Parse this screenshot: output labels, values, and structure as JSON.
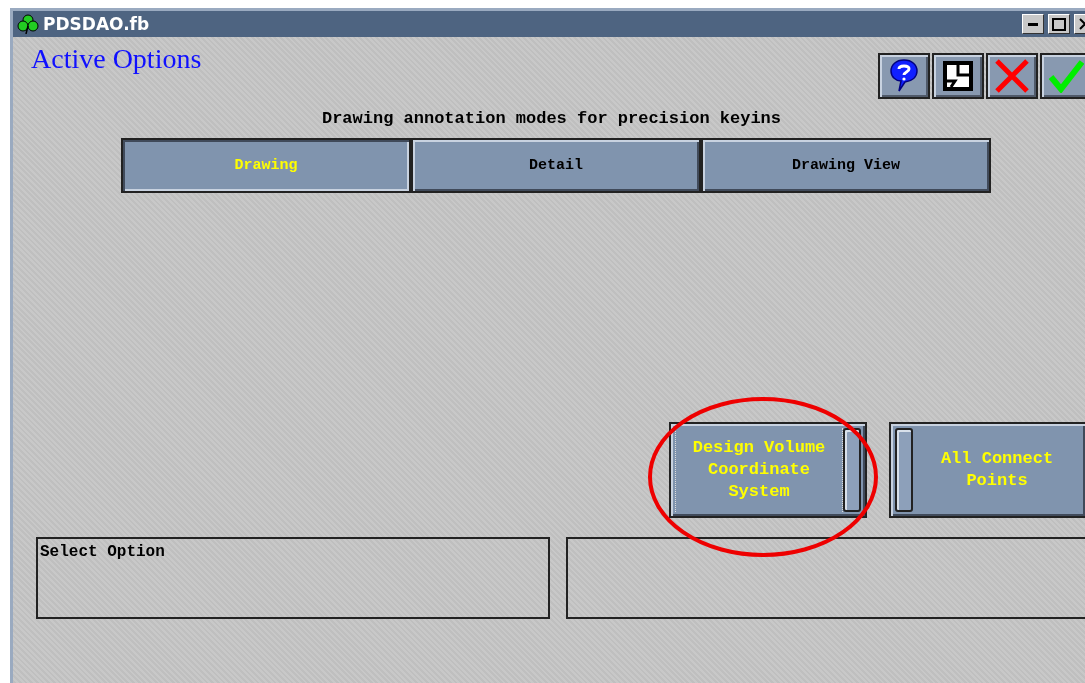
{
  "window": {
    "title": "PDSDAO.fb"
  },
  "form_title": "Active Options",
  "toolbar": [
    {
      "kind": "help"
    },
    {
      "kind": "layout"
    },
    {
      "kind": "cancel"
    },
    {
      "kind": "accept"
    }
  ],
  "heading": "Drawing annotation modes for precision keyins",
  "tabs": [
    {
      "label": "Drawing",
      "selected": true
    },
    {
      "label": "Detail",
      "selected": false
    },
    {
      "label": "Drawing View",
      "selected": false
    }
  ],
  "toggles": [
    {
      "label": "Design Volume Coordinate System",
      "on": true,
      "focused": true,
      "circled": true
    },
    {
      "label": "All Connect Points",
      "on": false,
      "focused": false,
      "circled": false
    }
  ],
  "message": "Select Option"
}
